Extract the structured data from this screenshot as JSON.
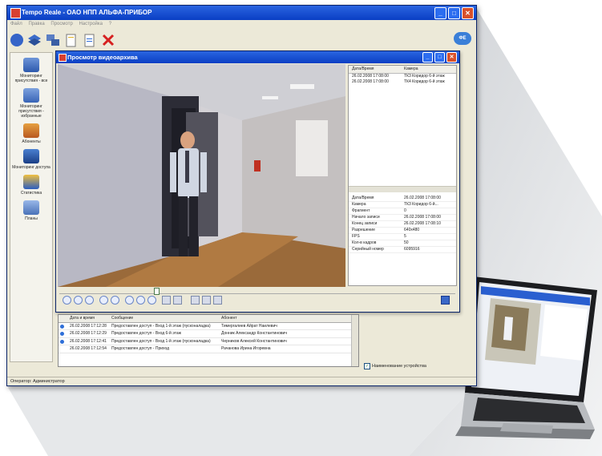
{
  "app": {
    "title": "Tempo Reale - ОАО НПП АЛЬФА-ПРИБОР",
    "menu": [
      "Файл",
      "Правка",
      "Просмотр",
      "Настройка",
      "?"
    ],
    "logo_badge": "ФЕ"
  },
  "toolbar": {
    "icons": [
      "monitor-icon",
      "layers-icon",
      "network-icon",
      "new-doc-icon",
      "doc-icon",
      "delete-icon"
    ]
  },
  "sidebar": {
    "items": [
      {
        "label": "Мониторинг присутствия - все",
        "icon": "people-monitor-icon"
      },
      {
        "label": "Мониторинг присутствия - избранные",
        "icon": "favorites-monitor-icon"
      },
      {
        "label": "Абоненты",
        "icon": "subscribers-icon"
      },
      {
        "label": "Мониторинг доступа",
        "icon": "door-icon"
      },
      {
        "label": "Статистика",
        "icon": "statistics-icon"
      },
      {
        "label": "Планы",
        "icon": "plans-icon"
      }
    ]
  },
  "video_window": {
    "title": "Просмотр видеоархива",
    "list_headers": [
      "Дата/Время",
      "Камера"
    ],
    "list_rows": [
      [
        "26.02.2008 17:08:00",
        "ТК3 Коридор 6-й этаж"
      ],
      [
        "26.02.2008 17:08:00",
        "ТК4 Коридор 6-й этаж"
      ]
    ],
    "props": [
      [
        "Дата/Время",
        "26.02.2008 17:08:00"
      ],
      [
        "Камера",
        "ТК3 Коридор 6-й..."
      ],
      [
        "Фрагмент",
        "0"
      ],
      [
        "Начало записи",
        "26.02.2008 17:08:00"
      ],
      [
        "Конец записи",
        "26.02.2008 17:08:10"
      ],
      [
        "Разрешение",
        "640x480"
      ],
      [
        "FPS",
        "5"
      ],
      [
        "Кол-в кадров",
        "50"
      ],
      [
        "Серийный номер",
        "6095916"
      ]
    ]
  },
  "events": {
    "headers": [
      "Дата и время",
      "Сообщение",
      "Абонент"
    ],
    "rows": [
      {
        "date": "26.02.2008 17:12:28",
        "message": "Предоставлен доступ - Вход 1-й этаж (пусконаладка)",
        "subscriber": "Тимергалиев Айрат Наилевич",
        "dot": true
      },
      {
        "date": "26.02.2008 17:12:29",
        "message": "Предоставлен доступ - Вход 6-й этаж",
        "subscriber": "Донник Александр Константинович",
        "dot": true
      },
      {
        "date": "26.02.2008 17:12:41",
        "message": "Предоставлен доступ - Вход 1-й этаж (пусконаладка)",
        "subscriber": "Черников Алексей Константинович",
        "dot": true
      },
      {
        "date": "26.02.2008 17:12:54",
        "message": "Предоставлен доступ - Приход",
        "subscriber": "Рачанова Ирина Игоревна",
        "dot": false
      }
    ]
  },
  "device_checkbox": "Наименование устройства",
  "status_bar": "Оператор: Администратор",
  "colors": {
    "titlebar": "#0a3fc4",
    "window_bg": "#ece9d8",
    "accent": "#2f6fd8"
  }
}
